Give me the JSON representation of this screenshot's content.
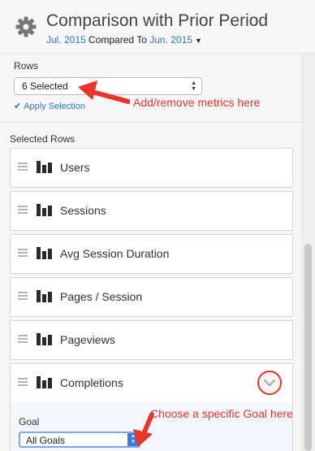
{
  "header": {
    "title": "Comparison with Prior Period",
    "period": "Jul. 2015",
    "compared_to_text": "Compared To",
    "prior_period": "Jun. 2015"
  },
  "rows_section": {
    "label": "Rows",
    "selected_value": "6 Selected",
    "apply_label": "Apply Selection"
  },
  "selected_rows": {
    "label": "Selected Rows",
    "items": [
      {
        "label": "Users"
      },
      {
        "label": "Sessions"
      },
      {
        "label": "Avg Session Duration"
      },
      {
        "label": "Pages / Session"
      },
      {
        "label": "Pageviews"
      },
      {
        "label": "Completions"
      }
    ]
  },
  "goal": {
    "label": "Goal",
    "selected_value": "All Goals"
  },
  "annotations": {
    "metrics_note": "Add/remove metrics here",
    "goal_note": "Choose a specific Goal here"
  },
  "colors": {
    "link": "#2b78c5",
    "annotation_red": "#e8352a",
    "panel_bg": "#f6f6f6"
  },
  "icons": [
    "gear-icon",
    "caret-down-icon",
    "checkmark-icon",
    "drag-handle-icon",
    "bar-chart-icon",
    "chevron-down-icon"
  ]
}
